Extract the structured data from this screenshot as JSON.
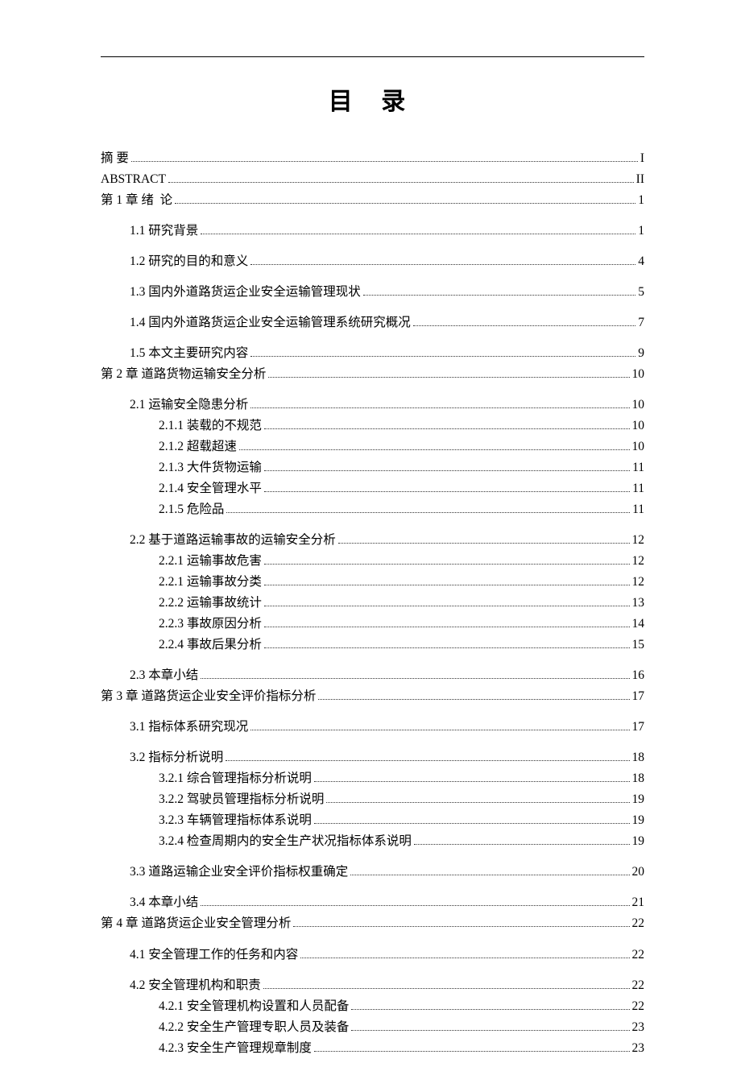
{
  "title": "目 录",
  "toc": [
    {
      "level": 0,
      "label": "摘 要",
      "page": "I",
      "gap": false
    },
    {
      "level": 0,
      "label": "ABSTRACT",
      "page": "II",
      "gap": false
    },
    {
      "level": 0,
      "label": "第 1 章 绪  论",
      "page": "1",
      "gap": false
    },
    {
      "level": 1,
      "label": "1.1 研究背景",
      "page": "1",
      "gap": true
    },
    {
      "level": 1,
      "label": "1.2 研究的目的和意义",
      "page": "4",
      "gap": true
    },
    {
      "level": 1,
      "label": "1.3 国内外道路货运企业安全运输管理现状",
      "page": "5",
      "gap": true
    },
    {
      "level": 1,
      "label": "1.4 国内外道路货运企业安全运输管理系统研究概况",
      "page": "7",
      "gap": true
    },
    {
      "level": 1,
      "label": "1.5 本文主要研究内容",
      "page": "9",
      "gap": true
    },
    {
      "level": 0,
      "label": "第 2 章 道路货物运输安全分析",
      "page": "10",
      "gap": false
    },
    {
      "level": 1,
      "label": "2.1 运输安全隐患分析",
      "page": "10",
      "gap": true
    },
    {
      "level": 2,
      "label": "2.1.1 装载的不规范",
      "page": "10",
      "gap": false
    },
    {
      "level": 2,
      "label": "2.1.2 超载超速",
      "page": "10",
      "gap": false
    },
    {
      "level": 2,
      "label": "2.1.3 大件货物运输",
      "page": "11",
      "gap": false
    },
    {
      "level": 2,
      "label": "2.1.4 安全管理水平",
      "page": "11",
      "gap": false
    },
    {
      "level": 2,
      "label": "2.1.5 危险品",
      "page": "11",
      "gap": false
    },
    {
      "level": 1,
      "label": "2.2 基于道路运输事故的运输安全分析",
      "page": "12",
      "gap": true
    },
    {
      "level": 2,
      "label": "2.2.1 运输事故危害",
      "page": "12",
      "gap": false
    },
    {
      "level": 2,
      "label": "2.2.1 运输事故分类",
      "page": "12",
      "gap": false
    },
    {
      "level": 2,
      "label": "2.2.2 运输事故统计",
      "page": "13",
      "gap": false
    },
    {
      "level": 2,
      "label": "2.2.3 事故原因分析",
      "page": "14",
      "gap": false
    },
    {
      "level": 2,
      "label": "2.2.4 事故后果分析",
      "page": "15",
      "gap": false
    },
    {
      "level": 1,
      "label": "2.3 本章小结",
      "page": "16",
      "gap": true
    },
    {
      "level": 0,
      "label": "第 3 章 道路货运企业安全评价指标分析",
      "page": "17",
      "gap": false
    },
    {
      "level": 1,
      "label": "3.1 指标体系研究现况",
      "page": "17",
      "gap": true
    },
    {
      "level": 1,
      "label": "3.2 指标分析说明",
      "page": "18",
      "gap": true
    },
    {
      "level": 2,
      "label": "3.2.1 综合管理指标分析说明",
      "page": "18",
      "gap": false
    },
    {
      "level": 2,
      "label": "3.2.2 驾驶员管理指标分析说明",
      "page": "19",
      "gap": false
    },
    {
      "level": 2,
      "label": "3.2.3 车辆管理指标体系说明",
      "page": "19",
      "gap": false
    },
    {
      "level": 2,
      "label": "3.2.4 检查周期内的安全生产状况指标体系说明",
      "page": "19",
      "gap": false
    },
    {
      "level": 1,
      "label": "3.3 道路运输企业安全评价指标权重确定",
      "page": "20",
      "gap": true
    },
    {
      "level": 1,
      "label": "3.4 本章小结",
      "page": "21",
      "gap": true
    },
    {
      "level": 0,
      "label": "第 4 章 道路货运企业安全管理分析",
      "page": "22",
      "gap": false
    },
    {
      "level": 1,
      "label": "4.1 安全管理工作的任务和内容",
      "page": "22",
      "gap": true
    },
    {
      "level": 1,
      "label": "4.2 安全管理机构和职责",
      "page": "22",
      "gap": true
    },
    {
      "level": 2,
      "label": "4.2.1 安全管理机构设置和人员配备",
      "page": "22",
      "gap": false
    },
    {
      "level": 2,
      "label": "4.2.2 安全生产管理专职人员及装备",
      "page": "23",
      "gap": false
    },
    {
      "level": 2,
      "label": "4.2.3 安全生产管理规章制度",
      "page": "23",
      "gap": false
    }
  ]
}
